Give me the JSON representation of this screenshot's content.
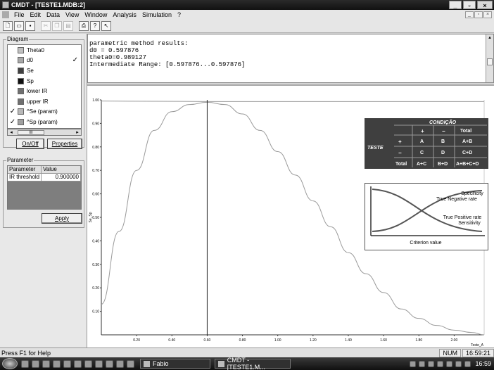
{
  "window": {
    "title": "CMDT - [TESTE1.MDB:2]",
    "min_label": "_",
    "max_label": "▫",
    "close_label": "×"
  },
  "menu": {
    "items": [
      "File",
      "Edit",
      "Data",
      "View",
      "Window",
      "Analysis",
      "Simulation",
      "?"
    ],
    "mdi_min": "_",
    "mdi_max": "▫",
    "mdi_close": "×"
  },
  "toolbar": {
    "buttons": [
      "new-file-icon",
      "open-folder-icon",
      "save-icon",
      "cut-icon",
      "copy-icon",
      "paste-icon",
      "print-icon",
      "help-icon",
      "context-help-icon"
    ]
  },
  "diagram": {
    "group_label": "Diagram",
    "items": [
      {
        "label": "Theta0",
        "checked": false,
        "color": "#c0c0c0"
      },
      {
        "label": "d0",
        "checked": false,
        "color": "#a8a8a8",
        "right_check": true
      },
      {
        "label": "Se",
        "checked": false,
        "color": "#404040"
      },
      {
        "label": "Sp",
        "checked": false,
        "color": "#101010"
      },
      {
        "label": "lower IR",
        "checked": false,
        "color": "#707070"
      },
      {
        "label": "upper IR",
        "checked": false,
        "color": "#707070"
      },
      {
        "label": "^Se (param)",
        "checked": true,
        "color": "#b8b8b8"
      },
      {
        "label": "^Sp (param)",
        "checked": true,
        "color": "#a0a0a0"
      }
    ],
    "scroll_thumb": "III",
    "onoff_label": "On/Off",
    "properties_label": "Properties"
  },
  "parameter": {
    "group_label": "Parameter",
    "col_parameter": "Parameter",
    "col_value": "Value",
    "row_name": "IR threshold",
    "row_value": "0.900000",
    "apply_label": "Apply"
  },
  "results": {
    "line1": "parametric method results:",
    "line2": "d0 = 0.597876",
    "line3": "theta0=0.989127",
    "line4": "Intermediate Range: [0.597876...0.597876]"
  },
  "chart_data": {
    "type": "line",
    "xlabel": "Teste_A",
    "ylabel": "Se, Sp",
    "xlim": [
      0.0,
      2.17
    ],
    "ylim": [
      0.0,
      1.0
    ],
    "x_ticks": [
      "0.20",
      "0.40",
      "0.60",
      "0.80",
      "1.00",
      "1.20",
      "1.40",
      "1.60",
      "1.80",
      "2.00"
    ],
    "y_ticks": [
      "1.00",
      "0.90",
      "0.80",
      "0.70",
      "0.60",
      "0.50",
      "0.40",
      "0.30",
      "0.20",
      "0.10"
    ],
    "series": [
      {
        "values_x": [
          0.0,
          0.1,
          0.2,
          0.3,
          0.4,
          0.5,
          0.6,
          0.7,
          0.8,
          0.9,
          1.0,
          1.1,
          1.2,
          1.3,
          1.4,
          1.5,
          1.6,
          1.7,
          1.8,
          1.9,
          2.0,
          2.1,
          2.17
        ],
        "values_y": [
          0.13,
          0.44,
          0.7,
          0.87,
          0.95,
          0.98,
          0.99,
          0.98,
          0.94,
          0.87,
          0.78,
          0.68,
          0.57,
          0.46,
          0.35,
          0.26,
          0.18,
          0.11,
          0.07,
          0.04,
          0.02,
          0.01,
          0.0
        ],
        "color": "#9a9a9a"
      },
      {
        "values_x": [
          0.0,
          0.3,
          0.6,
          0.9,
          1.2,
          1.5,
          1.8,
          2.17
        ],
        "values_y": [
          0.995,
          0.994,
          0.993,
          0.993,
          0.993,
          0.993,
          0.993,
          0.993
        ],
        "color": "#9a9a9a"
      }
    ],
    "marker_x": 0.6,
    "grid": false
  },
  "inset_table": {
    "header": "CONDIÇÃO",
    "row_label": "TESTE",
    "plus": "+",
    "minus": "−",
    "total": "Total",
    "a": "A",
    "b": "B",
    "c": "C",
    "d": "D",
    "ab": "A+B",
    "cd": "C+D",
    "ac": "A+C",
    "bd": "B+D",
    "abcd": "A+B+C+D"
  },
  "inset_curve": {
    "specificity": "Specificity",
    "true_negative": "True Negative rate",
    "true_positive": "True Positive rate",
    "sensitivity": "Sensitivity",
    "xlabel": "Criterion value"
  },
  "status": {
    "text": "Press F1 for Help",
    "num": "NUM",
    "time": "16:59:21"
  },
  "taskbar": {
    "task1": "Fabio",
    "task2": "CMDT - [TESTE1.M...",
    "clock": "16:59"
  }
}
